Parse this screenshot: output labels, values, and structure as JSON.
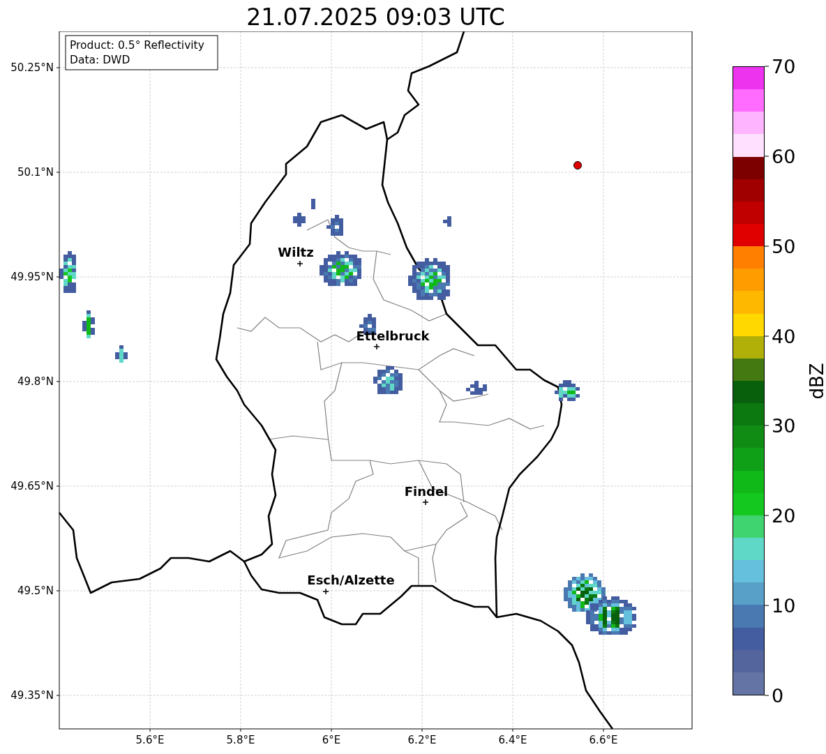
{
  "title": "21.07.2025 09:03 UTC",
  "legend": [
    "Product: 0.5° Reflectivity",
    "Data: DWD"
  ],
  "map": {
    "lat_ticks": [
      "50.25°N",
      "50.1°N",
      "49.95°N",
      "49.8°N",
      "49.65°N",
      "49.5°N",
      "49.35°N"
    ],
    "lon_ticks": [
      "5.6°E",
      "5.8°E",
      "6°E",
      "6.2°E",
      "6.4°E",
      "6.6°E"
    ],
    "cities": [
      "Wiltz",
      "Ettelbruck",
      "Findel",
      "Esch/Alzette"
    ]
  },
  "colorbar": {
    "ticks": [
      "70",
      "60",
      "50",
      "40",
      "30",
      "20",
      "10",
      "0"
    ],
    "bins": [
      {
        "color": "#ee33ee"
      },
      {
        "color": "#ff6cff"
      },
      {
        "color": "#ffb4ff"
      },
      {
        "color": "#ffe0ff"
      },
      {
        "color": "#7c0000"
      },
      {
        "color": "#a00000"
      },
      {
        "color": "#c00000"
      },
      {
        "color": "#e00000"
      },
      {
        "color": "#ff8000"
      },
      {
        "color": "#ff9c00"
      },
      {
        "color": "#ffb800"
      },
      {
        "color": "#ffd800"
      },
      {
        "color": "#b0b008"
      },
      {
        "color": "#447810"
      },
      {
        "color": "#08600c"
      },
      {
        "color": "#0c7810"
      },
      {
        "color": "#108c14"
      },
      {
        "color": "#10a018"
      },
      {
        "color": "#10b818"
      },
      {
        "color": "#14c820"
      },
      {
        "color": "#40d470"
      },
      {
        "color": "#60d8c8"
      },
      {
        "color": "#64c0dc"
      },
      {
        "color": "#58a0c8"
      },
      {
        "color": "#4a78b0"
      },
      {
        "color": "#445da0"
      },
      {
        "color": "#53659c"
      },
      {
        "color": "#6474a4"
      }
    ],
    "label": "dBZ"
  }
}
